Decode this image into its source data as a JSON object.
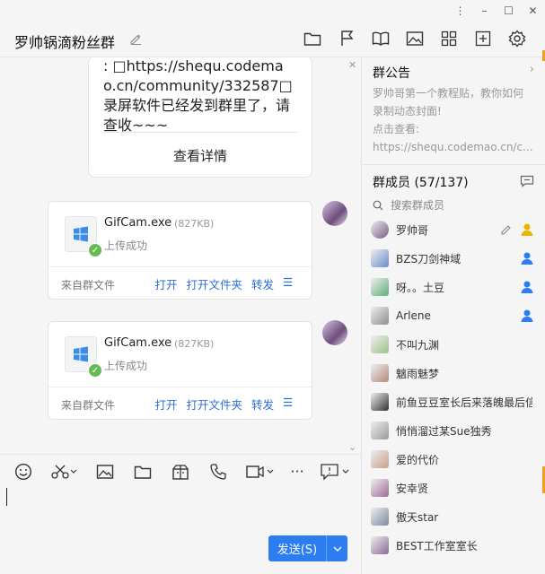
{
  "window": {
    "minimize": "–",
    "maximize": "☐",
    "close": "✕",
    "pin": "⋮"
  },
  "header": {
    "title": "罗帅锅滴粉丝群"
  },
  "chat": {
    "top_card": {
      "lines": [
        ": □https://shequ.codema",
        "o.cn/community/332587□",
        "录屏软件已经发到群里了，请",
        "查收~~~"
      ],
      "view_more": "查看详情"
    },
    "files": [
      {
        "name": "GifCam.exe",
        "size": "(827KB)",
        "status": "上传成功",
        "source": "来自群文件",
        "actions": [
          "打开",
          "打开文件夹",
          "转发"
        ]
      },
      {
        "name": "GifCam.exe",
        "size": "(827KB)",
        "status": "上传成功",
        "source": "来自群文件",
        "actions": [
          "打开",
          "打开文件夹",
          "转发"
        ]
      }
    ]
  },
  "composer": {
    "send_label": "发送(S)"
  },
  "announcement": {
    "title": "群公告",
    "lines": [
      "罗帅哥第一个教程贴，教你如何",
      "录制动态封面!",
      "点击查看:",
      "https://shequ.codemao.cn/c..."
    ]
  },
  "members": {
    "title": "群成员 (57/137)",
    "search_placeholder": "搜索群成员",
    "list": [
      {
        "name": "罗帅哥",
        "role": "owner",
        "color": "#7a5a8a"
      },
      {
        "name": "BZS刀剑神域",
        "role": "admin",
        "color": "#6b8cc9"
      },
      {
        "name": "呀。。土豆",
        "role": "admin",
        "color": "#5fae7a"
      },
      {
        "name": "Arlene",
        "role": "admin",
        "color": "#8e8e8e"
      },
      {
        "name": "不叫九渊",
        "role": "",
        "color": "#9cc28a"
      },
      {
        "name": "魑雨魅梦",
        "role": "",
        "color": "#b68a7a"
      },
      {
        "name": "前鱼豆豆室长后来落魄最后信",
        "role": "",
        "color": "#333333"
      },
      {
        "name": "悄悄溜过某Sue独秀",
        "role": "",
        "color": "#9a9a9a"
      },
      {
        "name": "爱的代价",
        "role": "",
        "color": "#c9a08a"
      },
      {
        "name": "安幸贤",
        "role": "",
        "color": "#a06a9a"
      },
      {
        "name": "傲天star",
        "role": "",
        "color": "#7c8a9e"
      },
      {
        "name": "BEST工作室室长",
        "role": "",
        "color": "#8a6a9a"
      }
    ]
  },
  "colors": {
    "accent": "#2c7df0",
    "link": "#2c6fd6",
    "owner": "#f0b400",
    "admin": "#2c7df0",
    "success": "#66bb55"
  }
}
